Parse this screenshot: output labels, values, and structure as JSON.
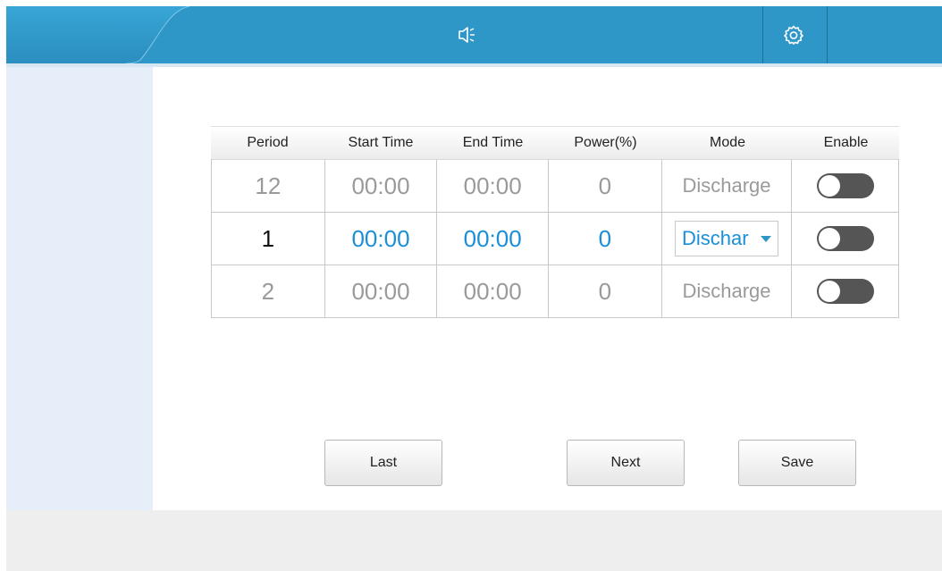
{
  "header": {
    "sound_icon": "speaker-icon",
    "settings_icon": "gear-icon",
    "color": "#2f97c8"
  },
  "table": {
    "columns": [
      "Period",
      "Start Time",
      "End Time",
      "Power(%)",
      "Mode",
      "Enable"
    ],
    "rows": [
      {
        "period": "12",
        "start": "00:00",
        "end": "00:00",
        "power": "0",
        "mode": "Discharge",
        "enabled": false
      },
      {
        "period": "1",
        "start": "00:00",
        "end": "00:00",
        "power": "0",
        "mode": "Dischar",
        "enabled": false
      },
      {
        "period": "2",
        "start": "00:00",
        "end": "00:00",
        "power": "0",
        "mode": "Discharge",
        "enabled": false
      }
    ]
  },
  "buttons": {
    "last": "Last",
    "next": "Next",
    "save": "Save"
  },
  "colors": {
    "accent": "#1a8fd8",
    "inactive_text": "#9a9a9a",
    "toggle_off": "#555555"
  }
}
